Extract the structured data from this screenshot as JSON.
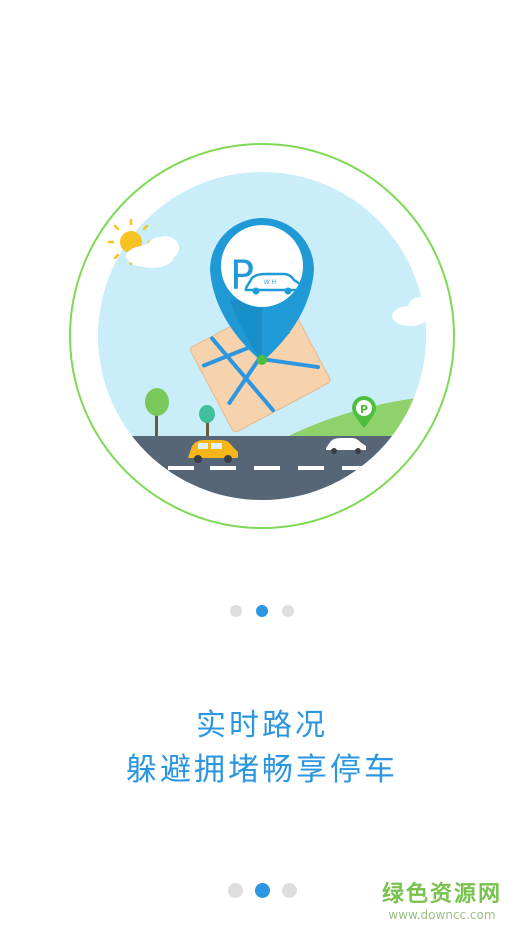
{
  "illustration": {
    "pin_letter": "P",
    "pin_badge_text": "W H",
    "parking_sign_letter": "P"
  },
  "pager_top": {
    "count": 3,
    "active_index": 1
  },
  "caption": {
    "line1": "实时路况",
    "line2": "躲避拥堵畅享停车"
  },
  "pager_bottom": {
    "count": 3,
    "active_index": 1
  },
  "watermark": {
    "brand": "绿色资源网",
    "url": "www.downcc.com"
  },
  "colors": {
    "accent_blue": "#2d96e0",
    "ring_green": "#7ed957",
    "sky": "#c7ecf8",
    "road": "#566676",
    "grass": "#8fd16a",
    "inactive_dot": "#dedede"
  }
}
